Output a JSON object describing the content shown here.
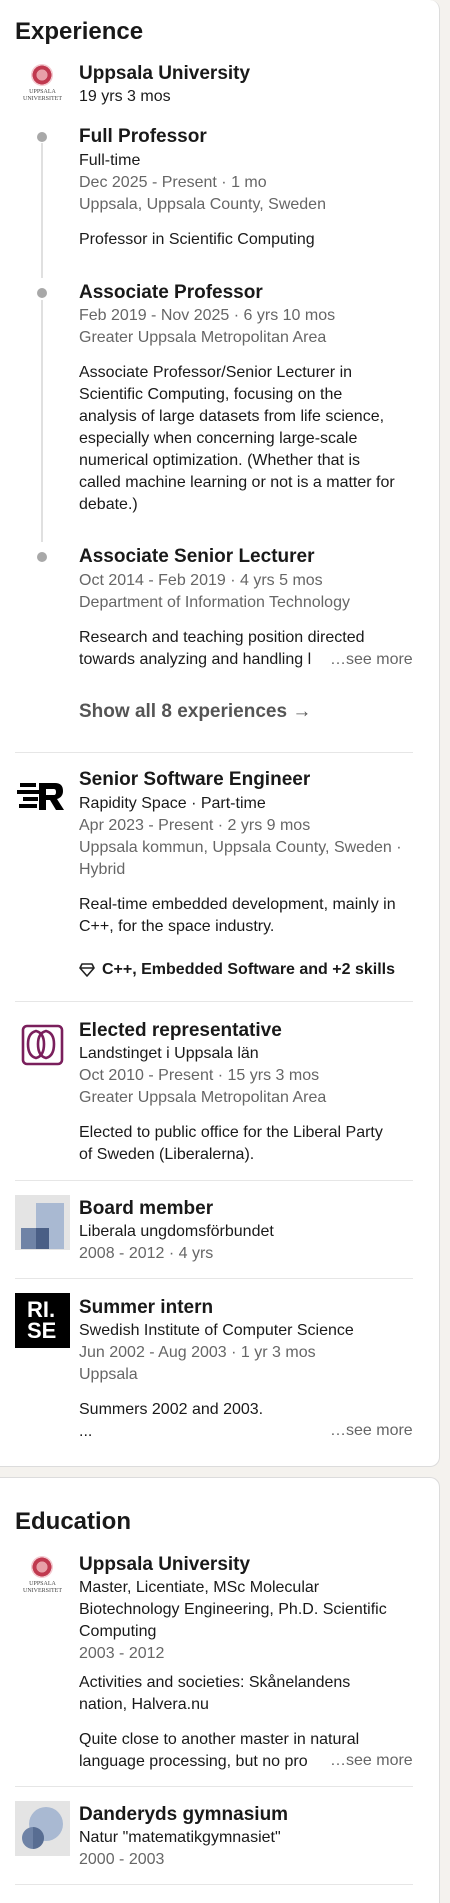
{
  "experience": {
    "heading": "Experience",
    "uppsala": {
      "logo_text_1": "UPPSALA",
      "logo_text_2": "UNIVERSITET",
      "company": "Uppsala University",
      "duration": "19 yrs 3 mos",
      "roles": [
        {
          "title": "Full Professor",
          "type": "Full-time",
          "dates": "Dec 2025 - Present · 1 mo",
          "location": "Uppsala, Uppsala County, Sweden",
          "description": "Professor in Scientific Computing"
        },
        {
          "title": "Associate Professor",
          "dates": "Feb 2019 - Nov 2025 · 6 yrs 10 mos",
          "location": "Greater Uppsala Metropolitan Area",
          "description_lines": [
            "Associate Professor/Senior Lecturer in",
            "Scientific Computing, focusing on the",
            "analysis of large datasets from life science,",
            "especially when concerning large-scale",
            "numerical optimization. (Whether that is",
            "called machine learning or not is a matter for",
            "debate.)"
          ]
        },
        {
          "title": "Associate Senior Lecturer",
          "dates": "Oct 2014 - Feb 2019 · 4 yrs 5 mos",
          "location": "Department of Information Technology",
          "description_lines": [
            "Research and teaching position directed",
            "towards analyzing and handling l"
          ],
          "see_more": "…see more"
        }
      ],
      "show_all": "Show all 8 experiences →"
    },
    "rapidity": {
      "title": "Senior Software Engineer",
      "company": "Rapidity Space · Part-time",
      "dates": "Apr 2023 - Present · 2 yrs 9 mos",
      "location_lines": [
        "Uppsala kommun, Uppsala County, Sweden ·",
        "Hybrid"
      ],
      "description_lines": [
        "Real-time embedded development, mainly in",
        "C++, for the space industry."
      ],
      "skills": "C++, Embedded Software and +2 skills",
      "brand_color": "#000000"
    },
    "landstinget": {
      "title": "Elected representative",
      "company": "Landstinget i Uppsala län",
      "dates": "Oct 2010 - Present · 15 yrs 3 mos",
      "location": "Greater Uppsala Metropolitan Area",
      "description_lines": [
        "Elected to public office for the Liberal Party",
        "of Sweden (Liberalerna)."
      ],
      "brand_color": "#7a1f5c"
    },
    "board": {
      "title": "Board member",
      "company": "Liberala ungdomsförbundet",
      "dates": "2008 - 2012 · 4 yrs"
    },
    "rise": {
      "logo_text_1": "RI.",
      "logo_text_2": "SE",
      "title": "Summer intern",
      "company": "Swedish Institute of Computer Science",
      "dates": "Jun 2002 - Aug 2003 · 1 yr 3 mos",
      "location": "Uppsala",
      "description_lines": [
        "Summers 2002 and 2003.",
        "..."
      ],
      "see_more": "…see more"
    }
  },
  "education": {
    "heading": "Education",
    "uppsala": {
      "logo_text_1": "UPPSALA",
      "logo_text_2": "UNIVERSITET",
      "school": "Uppsala University",
      "degree_lines": [
        "Master, Licentiate, MSc Molecular",
        "Biotechnology Engineering, Ph.D. Scientific",
        "Computing"
      ],
      "years": "2003 - 2012",
      "activities_lines": [
        "Activities and societies: Skånelandens",
        "nation, Halvera.nu"
      ],
      "description_lines": [
        "Quite close to another master in natural",
        "language processing, but no pro"
      ],
      "see_more": "…see more"
    },
    "danderyd": {
      "school": "Danderyds gymnasium",
      "program": "Natur \"matematikgymnasiet\"",
      "years": "2000 - 2003"
    }
  }
}
